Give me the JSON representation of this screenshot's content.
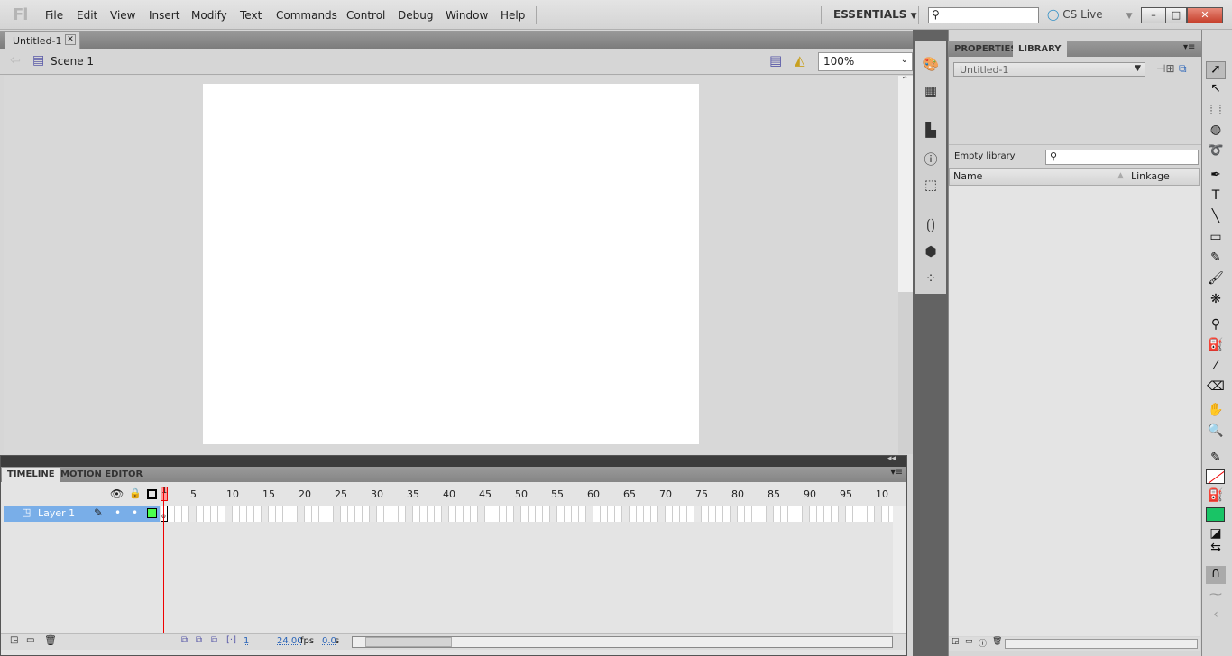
{
  "app": {
    "logo": "Fl",
    "menu": [
      "File",
      "Edit",
      "View",
      "Insert",
      "Modify",
      "Text",
      "Commands",
      "Control",
      "Debug",
      "Window",
      "Help"
    ],
    "workspace": "ESSENTIALS",
    "cs_live": "CS Live",
    "search_value": "",
    "window_buttons": {
      "minimize": "–",
      "restore": "□",
      "close": "✕"
    }
  },
  "document": {
    "tab": "Untitled-1",
    "scene": "Scene 1",
    "zoom": "100%"
  },
  "panels": {
    "tabs": [
      "PROPERTIES",
      "LIBRARY"
    ],
    "active_tab": "LIBRARY",
    "library": {
      "document": "Untitled-1",
      "status": "Empty library",
      "search_value": "",
      "columns": [
        "Name",
        "Linkage"
      ]
    }
  },
  "tools": {
    "stroke_color": "none",
    "fill_color": "#19c466"
  },
  "timeline": {
    "tabs": [
      "TIMELINE",
      "MOTION EDITOR"
    ],
    "active_tab": "TIMELINE",
    "layers": [
      {
        "name": "Layer 1",
        "color": "#4cff4c"
      }
    ],
    "frame_labels": [
      "1",
      "5",
      "10",
      "15",
      "20",
      "25",
      "30",
      "35",
      "40",
      "45",
      "50",
      "55",
      "60",
      "65",
      "70",
      "75",
      "80",
      "85",
      "90",
      "95",
      "10"
    ],
    "current_frame": "1",
    "fps": "24.00",
    "fps_unit": "fps",
    "time": "0.0",
    "time_unit": "s"
  }
}
